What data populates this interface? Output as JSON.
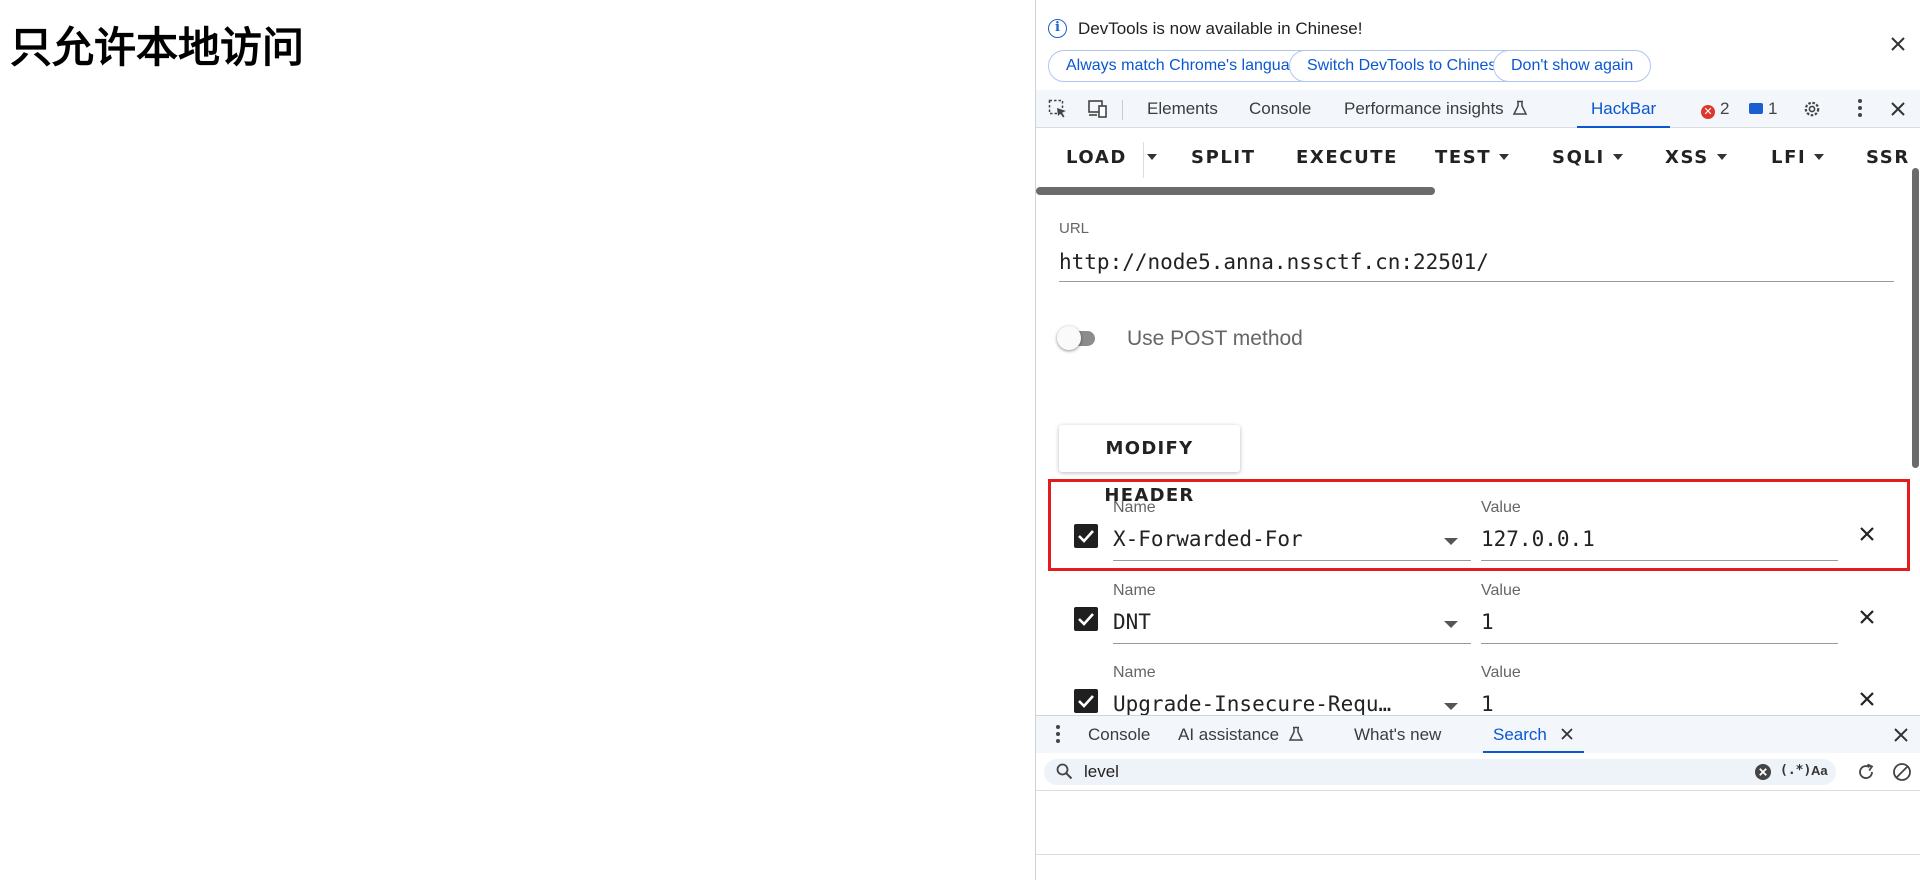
{
  "page": {
    "heading": "只允许本地访问"
  },
  "infobar": {
    "message": "DevTools is now available in Chinese!",
    "buttons": [
      "Always match Chrome's language",
      "Switch DevTools to Chinese",
      "Don't show again"
    ]
  },
  "tabs": {
    "elements": "Elements",
    "console": "Console",
    "performance": "Performance insights",
    "hackbar": "HackBar",
    "error_count": "2",
    "message_count": "1"
  },
  "hackbar_toolbar": {
    "load": "LOAD",
    "split": "SPLIT",
    "execute": "EXECUTE",
    "test": "TEST",
    "sqli": "SQLI",
    "xss": "XSS",
    "lfi": "LFI",
    "ssrf": "SSRF"
  },
  "url": {
    "label": "URL",
    "value": "http://node5.anna.nssctf.cn:22501/"
  },
  "post_toggle": {
    "label": "Use POST method",
    "enabled": false
  },
  "modify_header": {
    "label": "MODIFY HEADER"
  },
  "headers": [
    {
      "name_label": "Name",
      "name": "X-Forwarded-For",
      "value_label": "Value",
      "value": "127.0.0.1",
      "checked": true
    },
    {
      "name_label": "Name",
      "name": "DNT",
      "value_label": "Value",
      "value": "1",
      "checked": true
    },
    {
      "name_label": "Name",
      "name": "Upgrade-Insecure-Requ…",
      "value_label": "Value",
      "value": "1",
      "checked": true
    }
  ],
  "drawer": {
    "tabs": {
      "console": "Console",
      "ai": "AI assistance",
      "whats_new": "What's new",
      "search": "Search"
    },
    "search_query": "level",
    "regex_toggle": "(.*)",
    "case_toggle": "Aa"
  },
  "colors": {
    "accent": "#0b57d0",
    "highlight": "#e31d1d",
    "error": "#dc362e"
  }
}
